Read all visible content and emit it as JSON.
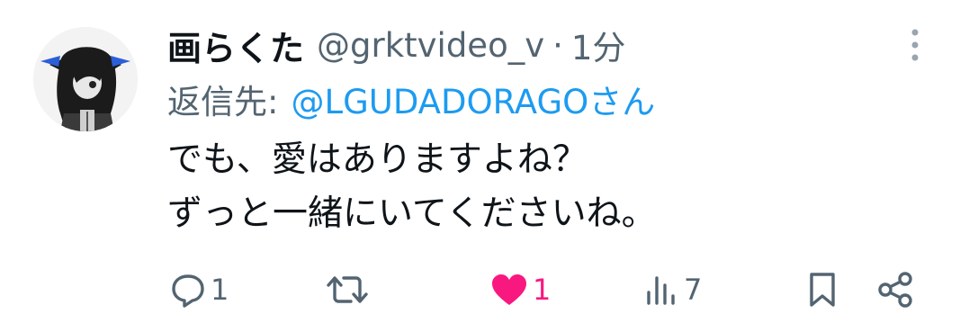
{
  "tweet": {
    "display_name": "画らくた",
    "handle": "@grktvideo_v",
    "separator": "·",
    "time": "1分",
    "reply_prefix": "返信先:",
    "reply_target": "@LGUDADORAGOさん",
    "body_lines": [
      "でも、愛はありますよね？",
      "ずっと一緒にいてくださいね。"
    ]
  },
  "actions": {
    "reply_count": "1",
    "retweet_count": "",
    "like_count": "1",
    "views_count": "7"
  },
  "colors": {
    "text_primary": "#0f1419",
    "text_secondary": "#536471",
    "link": "#1d9bf0",
    "like": "#f91880"
  },
  "icons": [
    "more-icon",
    "reply-icon",
    "retweet-icon",
    "heart-icon",
    "views-icon",
    "bookmark-icon",
    "share-icon"
  ]
}
